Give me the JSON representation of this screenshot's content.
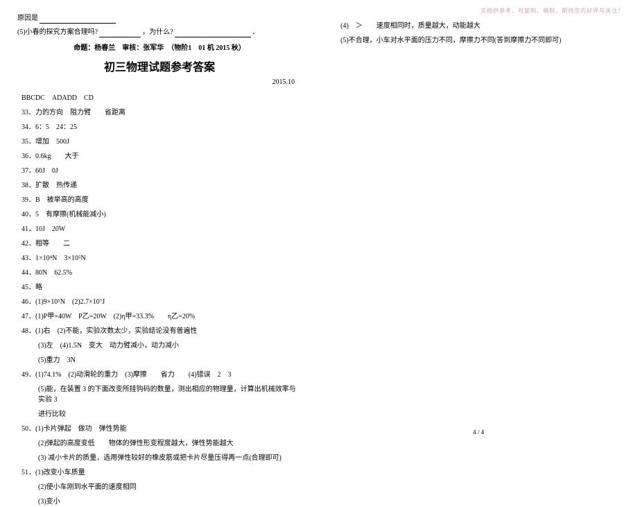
{
  "watermark": "文档供参考，可复制、编制，期待您的好评与关注！",
  "left": {
    "reason_label": "原因是",
    "q5_a": "(5)小春的探究方案合理吗?",
    "q5_b": "，为什么?",
    "credits": "命题：杨春兰　审核：张军华　（物阶1　01 机 2015 秋）",
    "title": "初三物理试题参考答案",
    "date": "2015.10",
    "mc": "BBCDC　ADADD　CD",
    "a33": "33．力的方向　阻力臂　　省距离",
    "a34": "34．6：5　24：25",
    "a35": "35．增加　500J",
    "a36": "36．0.6kg　　大于",
    "a37": "37．60J　0J",
    "a38": "38．扩散　热传递",
    "a39": "39．B　被举高的高度",
    "a40": "40．5　有摩擦(机械能减小)",
    "a41": "41．10J　20W",
    "a42": "42．相等　　二",
    "a43": "43．1×10⁴N　3×10⁵N",
    "a44": "44．80N　62.5%",
    "a45": "45．略",
    "a46": "46．(1)9×10⁵N　(2)2.7×10⁷J",
    "a47": "47．(1)P甲=40W　P乙=20W　(2)η甲=33.3%　　η乙=20%",
    "a48_1": "48．(1)右　(2)不能，实验次数太少，实验结论没有普遍性",
    "a48_3": "(3)左　(4)1.5N　变大　动力臂减小，动力减小",
    "a48_5": "(5)重力　3N",
    "a49_1": "49．(1)74.1%　(2)动滑轮的重力　(3)摩擦　　省力　　(4)错误　2　3",
    "a49_5": "(5)能，在装置 3 的下面改变所挂钩码的数量，测出相应的物理量，计算出机械效率与实验 3",
    "a49_5b": "进行比较",
    "a50_1": "50．(1)卡片弹起　做功　弹性势能",
    "a50_2": "(2)弹起的高度变低　　物体的弹性形变程度越大，弹性势能越大",
    "a50_3": "(3) 减小卡片的质量，选用弹性较好的橡皮筋或把卡片尽量压得再一点(合理即可)",
    "a51_1": "51．(1)改变小车质量",
    "a51_2": "(2)使小车刚到水平面的速度相同",
    "a51_3": "(3)变小"
  },
  "right": {
    "a4": "(4)　＞　　速度相同时，质量越大，动能越大",
    "a5": "(5)不合理，小车对水平面的压力不同，摩擦力不同(答到摩擦力不同即可)"
  },
  "page_num": "4 / 4"
}
